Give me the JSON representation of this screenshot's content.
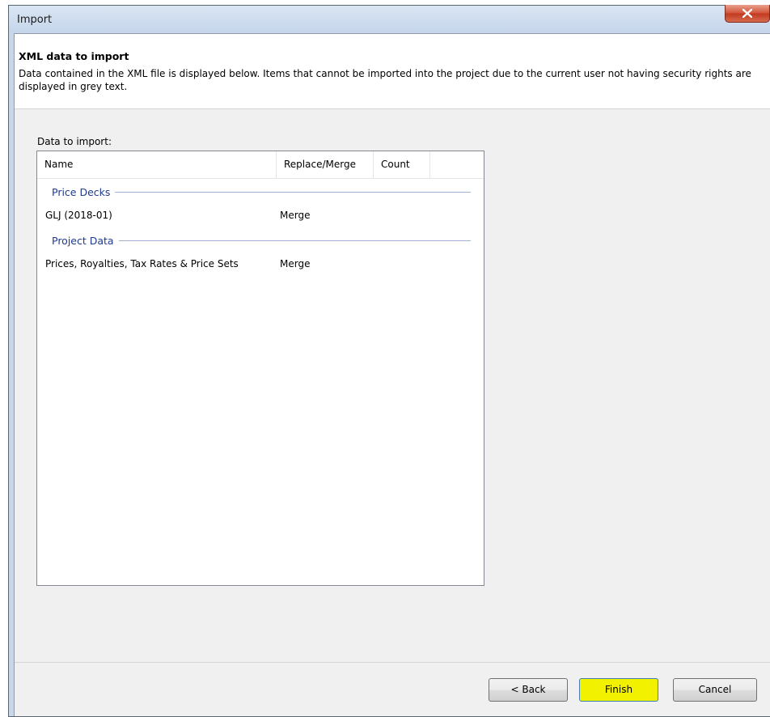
{
  "window": {
    "title": "Import"
  },
  "header": {
    "title": "XML data to import",
    "description": "Data contained in the XML file is displayed below.  Items that cannot be imported into the project due to the current user not having security rights are displayed in grey text."
  },
  "list": {
    "label": "Data to import:",
    "columns": {
      "name": "Name",
      "replace_merge": "Replace/Merge",
      "count": "Count"
    },
    "groups": [
      {
        "name": "Price Decks",
        "rows": [
          {
            "name": "GLJ (2018-01)",
            "replace_merge": "Merge",
            "count": ""
          }
        ]
      },
      {
        "name": "Project Data",
        "rows": [
          {
            "name": "Prices, Royalties, Tax Rates & Price Sets",
            "replace_merge": "Merge",
            "count": ""
          }
        ]
      }
    ]
  },
  "buttons": {
    "back": "< Back",
    "finish": "Finish",
    "cancel": "Cancel"
  },
  "colors": {
    "group_header": "#1e3a8f",
    "finish_highlight": "#f2f200"
  }
}
